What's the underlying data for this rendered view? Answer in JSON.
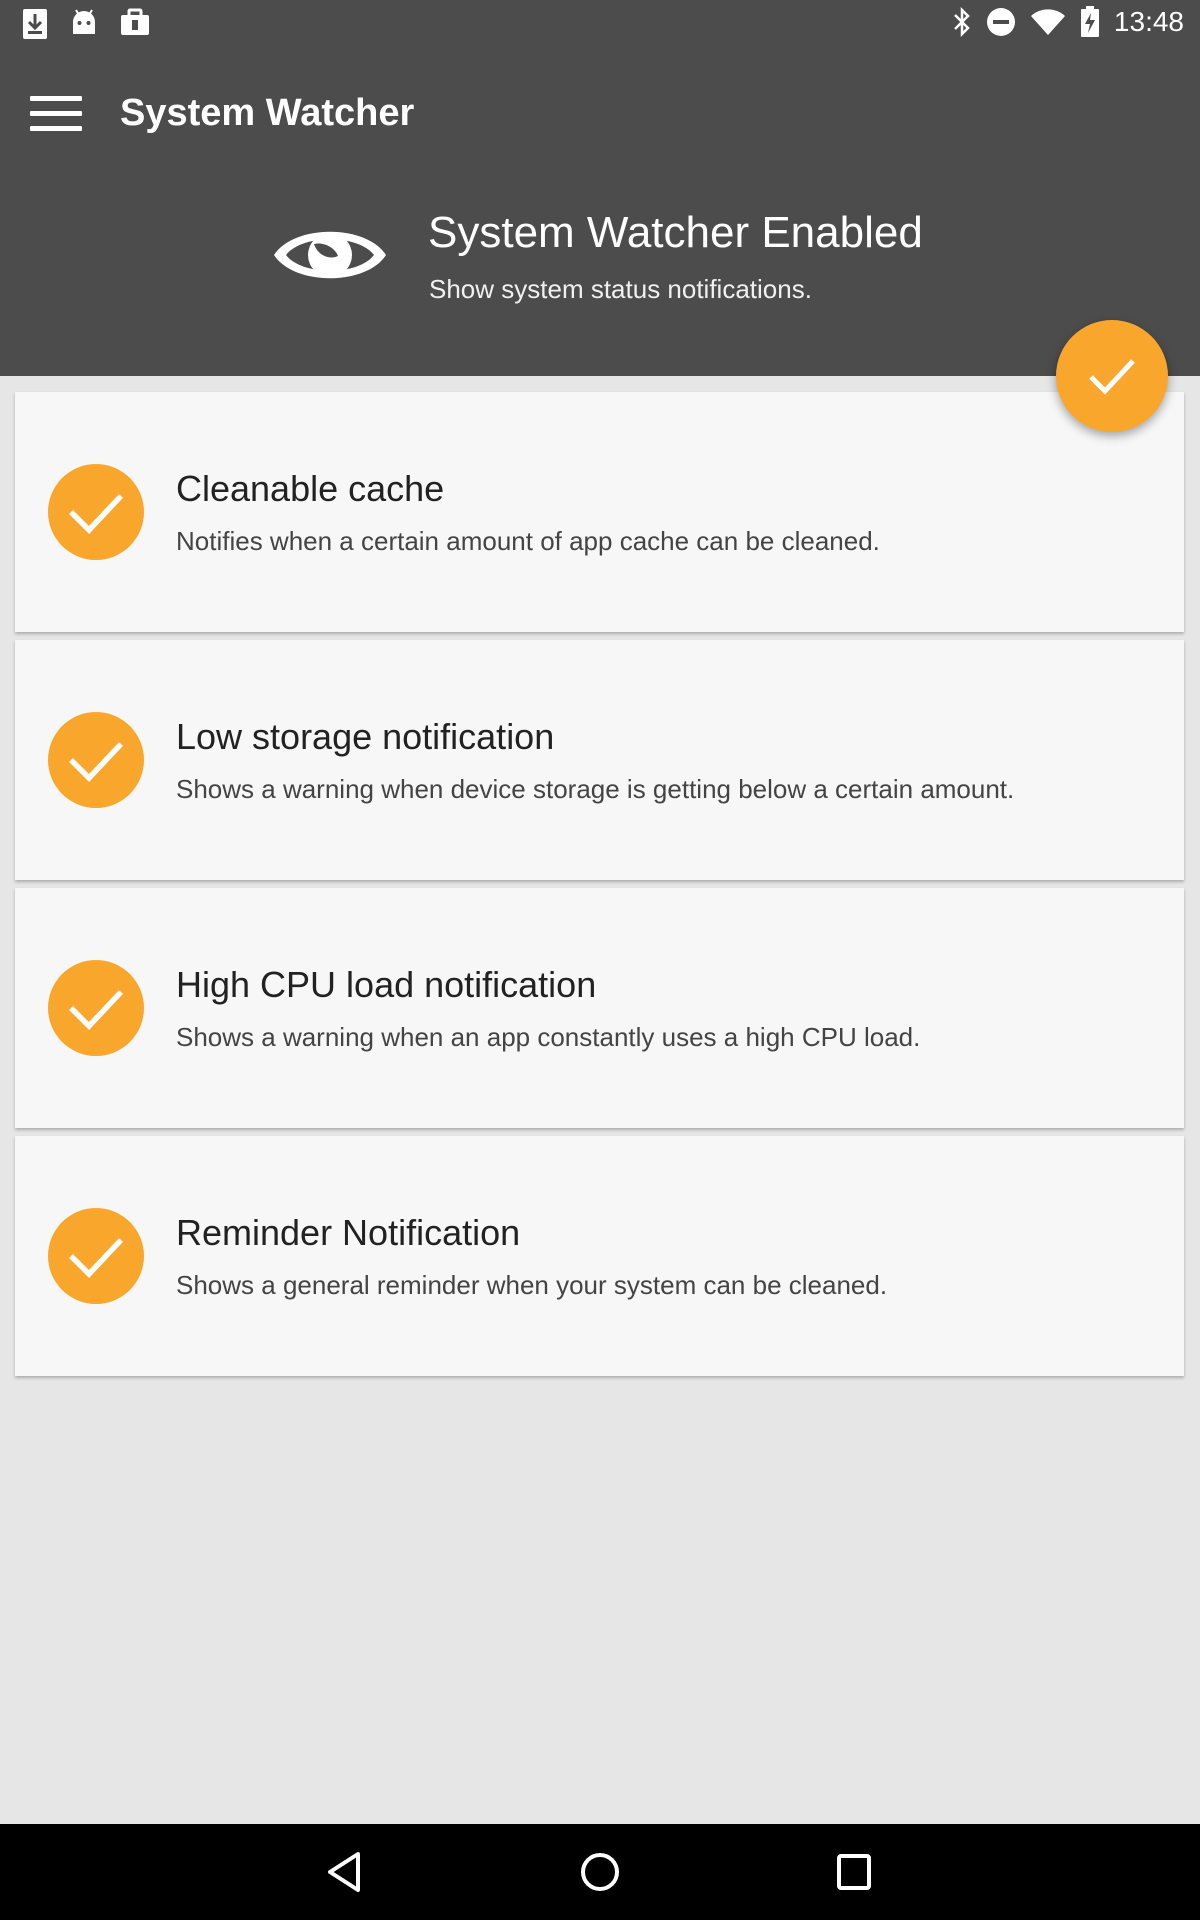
{
  "status_bar": {
    "time": "13:48",
    "left_icons": [
      "download-icon",
      "android-icon",
      "briefcase-icon"
    ],
    "right_icons": [
      "bluetooth-icon",
      "do-not-disturb-icon",
      "wifi-icon",
      "battery-charging-icon"
    ]
  },
  "app_bar": {
    "title": "System Watcher",
    "menu_icon": "menu-icon"
  },
  "header": {
    "icon": "eye-icon",
    "title": "System Watcher Enabled",
    "subtitle": "Show system status notifications."
  },
  "fab": {
    "icon": "check-icon",
    "color": "#f9a72c"
  },
  "settings": [
    {
      "title": "Cleanable cache",
      "description": "Notifies when a certain amount of app cache can be cleaned.",
      "enabled": true
    },
    {
      "title": "Low storage notification",
      "description": "Shows a warning when device storage is getting below a certain amount.",
      "enabled": true
    },
    {
      "title": "High CPU load notification",
      "description": "Shows a warning when an app constantly uses a high CPU load.",
      "enabled": true
    },
    {
      "title": "Reminder Notification",
      "description": "Shows a general reminder when your system can be cleaned.",
      "enabled": true
    }
  ],
  "nav_bar": {
    "buttons": [
      "back-icon",
      "home-icon",
      "recents-icon"
    ]
  },
  "colors": {
    "header_bg": "#4c4c4d",
    "accent": "#f9a72c",
    "background": "#e6e6e6",
    "card_bg": "#f7f7f7"
  }
}
